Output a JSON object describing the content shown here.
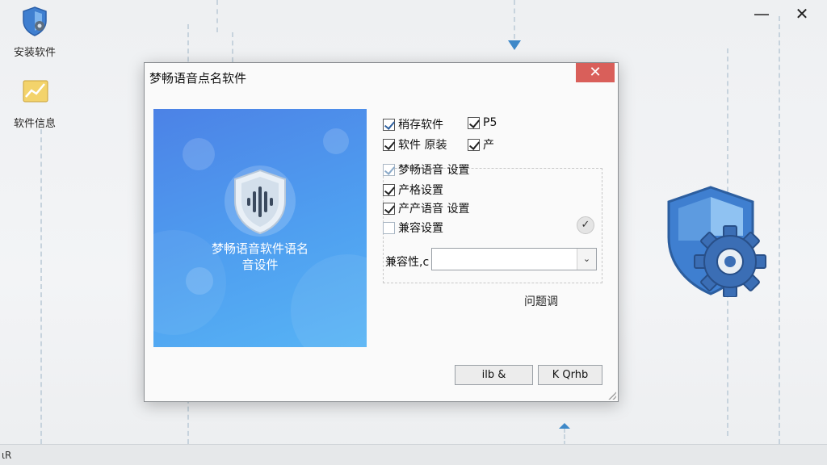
{
  "desktop": {
    "icons": [
      {
        "label": "安装软件",
        "icon": "shield-icon"
      },
      {
        "label": "软件信息",
        "icon": "chart-icon"
      }
    ],
    "window_controls": {
      "minimize": "—",
      "close": "✕"
    }
  },
  "taskbar": {
    "text": "ιR"
  },
  "dialog": {
    "title": "梦畅语音点名软件",
    "close_label": "✕",
    "banner": {
      "line1": "梦畅语音软件语名",
      "line2": "音设件"
    },
    "checkboxes": [
      {
        "label": "稍存软件",
        "checked": true
      },
      {
        "label": "P5",
        "checked": true
      },
      {
        "label": "软件 原装",
        "checked": true
      },
      {
        "label": "产",
        "checked": true
      },
      {
        "label": "梦畅语音  设置",
        "checked": true
      },
      {
        "label": "产格设置",
        "checked": true
      },
      {
        "label": "产产语音  设置",
        "checked": true
      },
      {
        "label": "兼容设置",
        "checked": false
      }
    ],
    "round_check": "✓",
    "combo": {
      "label": "兼容性,c",
      "value": "",
      "arrow": "⌄"
    },
    "static_text": "问题调",
    "buttons": {
      "ok": "ilb  &",
      "cancel": "K Qrhb"
    }
  },
  "colors": {
    "accent": "#4f9ff0",
    "close_red": "#d95f5a",
    "shield_blue": "#3f7fd0"
  }
}
